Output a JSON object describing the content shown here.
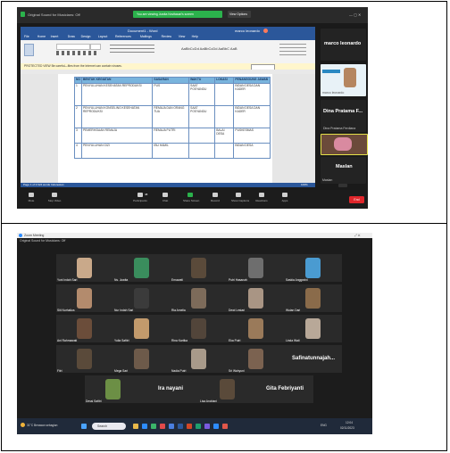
{
  "shot1": {
    "window_title": "Original Sound for Musicians: Off",
    "green_banner": "You are viewing Juwita Novitasari's screen",
    "view_options": "View Options",
    "window_controls": "— ▢ ✕",
    "word": {
      "title": "Document1 - Word",
      "user": "marco leonardo",
      "tabs": [
        "File",
        "Home",
        "Insert",
        "Draw",
        "Design",
        "Layout",
        "References",
        "Mailings",
        "Review",
        "View",
        "Help"
      ],
      "ribbon_sample": "AaBbCcDd  AaBbCcDd  AaBbC  AaB",
      "infobar": "PROTECTED VIEW  Be careful—files from the Internet can contain viruses.",
      "infobar_button": "Enable Editing",
      "status": "Page 1 of 3   624 words   Indonesian",
      "zoom": "100%"
    },
    "table": {
      "headers": [
        "NO",
        "BENTUK KEGIATAN",
        "SASARAN",
        "WAKTU",
        "LOKASI",
        "PENANGGUNG JAWAB"
      ],
      "rows": [
        [
          "1",
          "PENYULUHAN KESEHATAN REPRODUKSI",
          "PUS",
          "SAAT POSYANDU",
          "",
          "BIDAN DESA DAN KADER"
        ],
        [
          "2",
          "PENYULUHAN KONSELING KESEHATAN REPRODUKSI",
          "REMAJA DAN ORANG TUA",
          "SAAT POSYANDU",
          "",
          "BIDAN DESA DAN KADER"
        ],
        [
          "3",
          "PEMERIKSAAN REMAJA",
          "REMAJA PUTRI",
          "",
          "BALAI DESA",
          "PUSKESMAS"
        ],
        [
          "4",
          "PENYULUHAN GIZI",
          "IBU HAMIL",
          "",
          "",
          "BIDAN DESA"
        ]
      ]
    },
    "participants": [
      {
        "name": "marco leonardo",
        "sub": "marco leonardo"
      },
      {
        "name": "Dina Pratama F...",
        "sub": "Dina Pratama Ferdiana"
      },
      {
        "name": "Maslan",
        "sub": "Maslan"
      }
    ],
    "toolbar": [
      {
        "icon": "mic-icon",
        "label": "Mute"
      },
      {
        "icon": "video-icon",
        "label": "Stop Video"
      },
      {
        "icon": "participants-icon",
        "label": "Participants"
      },
      {
        "icon": "chat-icon",
        "label": "Chat"
      },
      {
        "icon": "share-screen-icon",
        "label": "Share Screen"
      },
      {
        "icon": "record-icon",
        "label": "Record"
      },
      {
        "icon": "show-captions-icon",
        "label": "Show Captions"
      },
      {
        "icon": "reactions-icon",
        "label": "Reactions"
      },
      {
        "icon": "apps-icon",
        "label": "Apps"
      }
    ],
    "participant_count": "48",
    "end_label": "End"
  },
  "shot2": {
    "app_title": "Zoom Meeting",
    "subtitle": "Original Sound for Musicians: Off",
    "tiles": [
      {
        "name": "Yuni Indah Sari",
        "bg": "#c9a98a",
        "type": "face"
      },
      {
        "name": "Ns. Juwita",
        "bg": "#3a8d5d",
        "type": "face"
      },
      {
        "name": "Ernawati",
        "bg": "#5a4a3a",
        "type": "face"
      },
      {
        "name": "Putri Hasanah",
        "bg": "#6e6e6e",
        "type": "face"
      },
      {
        "name": "Saskia Anggraini",
        "bg": "#4a9bd1",
        "type": "face"
      },
      {
        "name": "Siti Nurhaliza",
        "bg": "#b38b6d",
        "type": "face"
      },
      {
        "name": "Nur Indah Sari",
        "bg": "#3b3b3b",
        "type": "face"
      },
      {
        "name": "Ria Amelia",
        "bg": "#7d6b5a",
        "type": "face"
      },
      {
        "name": "Dewi Lestari",
        "bg": "#a99584",
        "type": "face"
      },
      {
        "name": "Wulan Dari",
        "bg": "#8a6b4a",
        "type": "face"
      },
      {
        "name": "Ani Rahmawati",
        "bg": "#6b4d3a",
        "type": "face"
      },
      {
        "name": "Yulia Safitri",
        "bg": "#c29a6c",
        "type": "face"
      },
      {
        "name": "Rina Kartika",
        "bg": "#52453a",
        "type": "face"
      },
      {
        "name": "Eka Putri",
        "bg": "#9a7a5a",
        "type": "face"
      },
      {
        "name": "Linda Wati",
        "bg": "#b8a898",
        "type": "face"
      },
      {
        "name": "Fitri",
        "bg": "#5a4a3a",
        "type": "face"
      },
      {
        "name": "Mega Sari",
        "bg": "#6d5a4a",
        "type": "face"
      },
      {
        "name": "Nadia Putri",
        "bg": "#a89a8a",
        "type": "face"
      },
      {
        "name": "Sri Wahyuni",
        "bg": "#7b6250",
        "type": "face"
      },
      {
        "name": "Safinatunnajah...",
        "bg": "#2a2a2a",
        "type": "name"
      },
      {
        "name": "Dessi Safitri",
        "bg": "#6c8f45",
        "type": "face"
      },
      {
        "name": "Ira nayani",
        "bg": "#2a2a2a",
        "type": "name"
      },
      {
        "name": "Lisa Andriani",
        "bg": "#5a4a3a",
        "type": "face"
      },
      {
        "name": "Gita Febriyanti",
        "bg": "#2a2a2a",
        "type": "name"
      }
    ],
    "taskbar": {
      "weather": "31°C  Berawan sebagian",
      "search_placeholder": "Search",
      "tray": "ENG",
      "time": "12:04",
      "date": "02/11/2023"
    }
  },
  "colors": {
    "zoom_bg": "#1a1a1a",
    "word_blue": "#2b579a",
    "banner_green": "#2bb24c",
    "end_red": "#e0262b",
    "table_header": "#79b4dd"
  }
}
